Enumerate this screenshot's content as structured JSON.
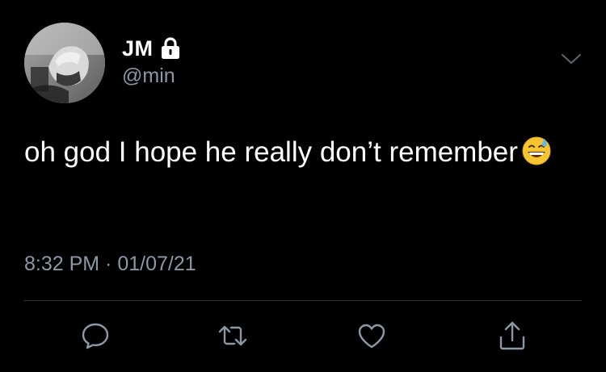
{
  "user": {
    "display_name": "JM",
    "handle": "@min",
    "protected_icon": "lock-icon",
    "avatar": "avatar"
  },
  "tweet": {
    "text": "oh god I hope he really don’t remember",
    "emoji": "grinning-face-with-sweat-emoji",
    "timestamp": "8:32 PM · 01/07/21"
  },
  "menu": {
    "icon": "chevron-down-icon"
  },
  "actions": [
    {
      "icon": "reply-icon"
    },
    {
      "icon": "retweet-icon"
    },
    {
      "icon": "like-icon"
    },
    {
      "icon": "share-icon"
    }
  ],
  "colors": {
    "background": "#000000",
    "text": "#ffffff",
    "secondary": "#8b98a5",
    "divider": "#2f3336"
  }
}
